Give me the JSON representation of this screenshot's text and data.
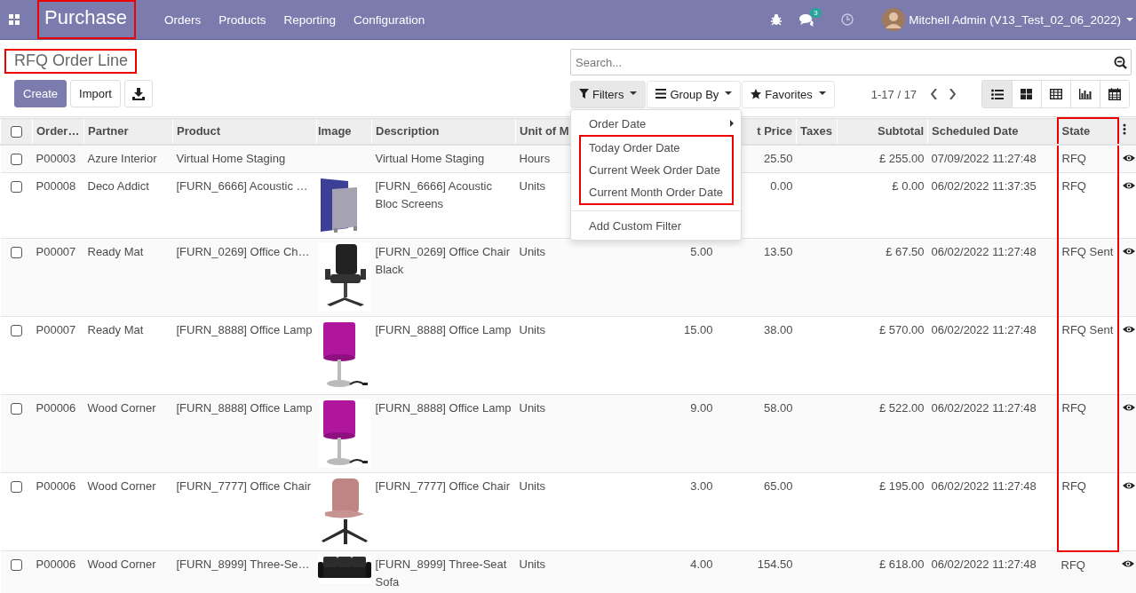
{
  "navbar": {
    "app_title": "Purchase",
    "app_title_highlighted": true,
    "menu": [
      "Orders",
      "Products",
      "Reporting",
      "Configuration"
    ],
    "messages_badge": "3",
    "user": "Mitchell Admin (V13_Test_02_06_2022)"
  },
  "breadcrumb": {
    "title": "RFQ Order Line",
    "highlighted": true
  },
  "buttons": [
    {
      "label": "Create",
      "kind": "primary"
    },
    {
      "label": "Import",
      "kind": "secondary"
    }
  ],
  "search": {
    "placeholder": "Search..."
  },
  "search_options": [
    {
      "label": "Filters",
      "kind": "filter",
      "expanded": true
    },
    {
      "label": "Group By",
      "kind": "group",
      "expanded": false
    },
    {
      "label": "Favorites",
      "kind": "favorite",
      "expanded": false
    }
  ],
  "filters_menu": [
    {
      "label": "Order Date",
      "kind": "submenu",
      "highlighted": false
    },
    {
      "label": "Today Order Date",
      "kind": "option",
      "highlighted": true
    },
    {
      "label": "Current Week Order Date",
      "kind": "option",
      "highlighted": true
    },
    {
      "label": "Current Month Order Date",
      "kind": "option",
      "highlighted": true
    },
    {
      "label": "Add Custom Filter",
      "kind": "action",
      "highlighted": false
    }
  ],
  "pager": "1-17 / 17",
  "views": [
    {
      "kind": "list",
      "selected": true
    },
    {
      "kind": "kanban",
      "selected": false
    },
    {
      "kind": "pivot",
      "selected": false
    },
    {
      "kind": "graph",
      "selected": false
    },
    {
      "kind": "calendar",
      "selected": false
    }
  ],
  "table": {
    "select_all_checked": false,
    "columns": [
      {
        "label": "Order…"
      },
      {
        "label": "Partner"
      },
      {
        "label": "Product"
      },
      {
        "label": "Image"
      },
      {
        "label": "Description"
      },
      {
        "label": "Unit of M"
      },
      {},
      {
        "label": "t Price"
      },
      {
        "label": "Taxes"
      },
      {
        "label": "Subtotal"
      },
      {
        "label": "Scheduled Date"
      },
      {
        "label": "State",
        "highlighted": true
      }
    ],
    "rows": [
      {
        "checked": false,
        "order": "P00003",
        "partner": "Azure Interior",
        "product": "Virtual Home Staging",
        "description": "Virtual Home Staging",
        "unit": "Hours",
        "unit_price": "25.50",
        "subtotal": "£ 255.00",
        "scheduled_date": "07/09/2022 11:27:48",
        "state": "RFQ",
        "state_highlighted": true
      },
      {
        "checked": false,
        "order": "P00008",
        "partner": "Deco Addict",
        "product": "[FURN_6666] Acoustic …",
        "description": "[FURN_6666] Acoustic Bloc Screens",
        "unit": "Units",
        "unit_price": "0.00",
        "subtotal": "£ 0.00",
        "scheduled_date": "06/02/2022 11:37:35",
        "state": "RFQ",
        "state_highlighted": true
      },
      {
        "checked": false,
        "order": "P00007",
        "partner": "Ready Mat",
        "product": "[FURN_0269] Office Ch…",
        "description": "[FURN_0269] Office Chair Black",
        "unit": "Units",
        "quantity": "5.00",
        "unit_price": "13.50",
        "subtotal": "£ 67.50",
        "scheduled_date": "06/02/2022 11:27:48",
        "state": "RFQ Sent",
        "state_highlighted": true
      },
      {
        "checked": false,
        "order": "P00007",
        "partner": "Ready Mat",
        "product": "[FURN_8888] Office Lamp",
        "description": "[FURN_8888] Office Lamp",
        "unit": "Units",
        "quantity": "15.00",
        "unit_price": "38.00",
        "subtotal": "£ 570.00",
        "scheduled_date": "06/02/2022 11:27:48",
        "state": "RFQ Sent",
        "state_highlighted": true
      },
      {
        "checked": false,
        "order": "P00006",
        "partner": "Wood Corner",
        "product": "[FURN_8888] Office Lamp",
        "description": "[FURN_8888] Office Lamp",
        "unit": "Units",
        "quantity": "9.00",
        "unit_price": "58.00",
        "subtotal": "£ 522.00",
        "scheduled_date": "06/02/2022 11:27:48",
        "state": "RFQ",
        "state_highlighted": true
      },
      {
        "checked": false,
        "order": "P00006",
        "partner": "Wood Corner",
        "product": "[FURN_7777] Office Chair",
        "description": "[FURN_7777] Office Chair",
        "unit": "Units",
        "quantity": "3.00",
        "unit_price": "65.00",
        "subtotal": "£ 195.00",
        "scheduled_date": "06/02/2022 11:27:48",
        "state": "RFQ",
        "state_highlighted": true
      },
      {
        "checked": false,
        "order": "P00006",
        "partner": "Wood Corner",
        "product": "[FURN_8999] Three-Se…",
        "description": "[FURN_8999] Three-Seat Sofa",
        "unit": "Units",
        "quantity": "4.00",
        "unit_price": "154.50",
        "subtotal": "£ 618.00",
        "scheduled_date": "06/02/2022 11:27:48",
        "state": "RFQ",
        "state_highlighted": false
      }
    ]
  }
}
